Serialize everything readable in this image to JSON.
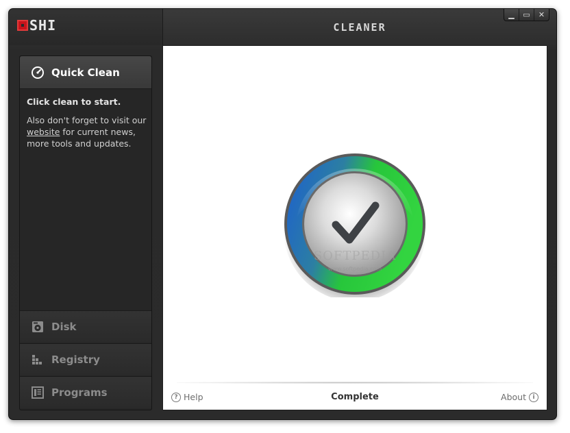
{
  "window": {
    "logo_text": "SHI",
    "title": "CLEANER",
    "controls": {
      "minimize": "▁",
      "maximize": "▭",
      "close": "✕"
    }
  },
  "sidebar": {
    "active_item": {
      "label": "Quick Clean",
      "icon": "gauge-icon"
    },
    "info": {
      "headline": "Click clean to start.",
      "text_before_link": "Also don't forget to visit our ",
      "link_text": "website",
      "text_after_link": " for current news, more tools and updates."
    },
    "items": [
      {
        "label": "Disk",
        "icon": "disk-icon"
      },
      {
        "label": "Registry",
        "icon": "registry-icon"
      },
      {
        "label": "Programs",
        "icon": "programs-icon"
      }
    ]
  },
  "main": {
    "badge_icon": "checkmark-icon",
    "watermark": "SOFTPEDIA",
    "watermark_sub": "www.softpedia.com",
    "footer": {
      "help_label": "Help",
      "status": "Complete",
      "about_label": "About"
    }
  },
  "colors": {
    "brand_red": "#c8141b",
    "ring_blue": "#1f63c9",
    "ring_green": "#2ccf3a"
  }
}
